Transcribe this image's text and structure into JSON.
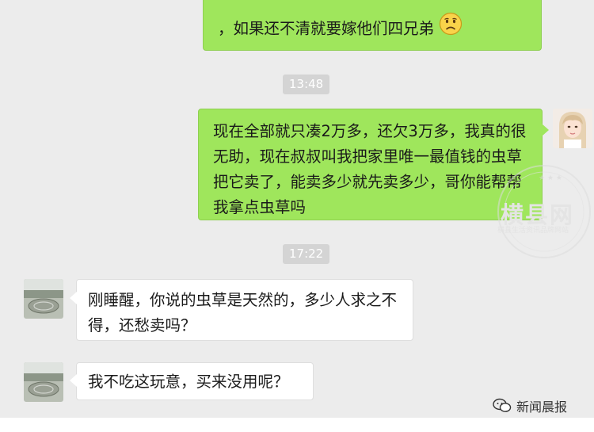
{
  "messages": [
    {
      "side": "mine",
      "text": "，如果还不清就要嫁他们四兄弟"
    },
    {
      "side": "mine",
      "text": "现在全部就只凑2万多，还欠3万多，我真的很无助，现在叔叔叫我把家里唯一最值钱的虫草把它卖了，能卖多少就先卖多少，哥你能帮帮我拿点虫草吗"
    },
    {
      "side": "theirs",
      "text": "刚睡醒，你说的虫草是天然的，多少人求之不得，还愁卖吗？"
    },
    {
      "side": "theirs",
      "text": "我不吃这玩意，买来没用呢？"
    }
  ],
  "timestamps": [
    "13:48",
    "17:22"
  ],
  "watermark": {
    "title": "横县网",
    "subtitle": "横县生活资讯品牌网站"
  },
  "badge": {
    "label": "新闻晨报"
  },
  "colors": {
    "mine_bubble": "#9fe65c",
    "theirs_bubble": "#ffffff",
    "background": "#ececec"
  },
  "icons": {
    "sad_emoji": "sad-face-icon",
    "badge_logo": "wechat-icon"
  }
}
